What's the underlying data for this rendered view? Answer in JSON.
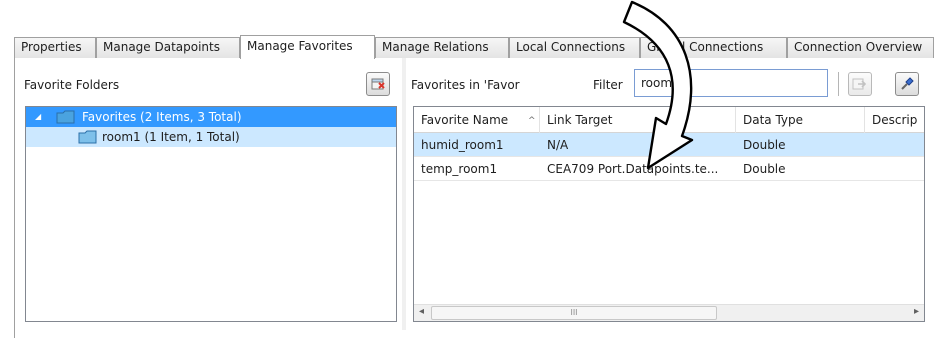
{
  "tabs": [
    {
      "label": "Properties"
    },
    {
      "label": "Manage Datapoints"
    },
    {
      "label": "Manage Favorites"
    },
    {
      "label": "Manage Relations"
    },
    {
      "label": "Local Connections"
    },
    {
      "label": "Global Connections"
    },
    {
      "label": "Connection Overview"
    }
  ],
  "active_tab": "Manage Favorites",
  "left": {
    "heading": "Favorite Folders",
    "add_button_icon": "add-folder-icon",
    "tree": [
      {
        "label": "Favorites (2 Items, 3 Total)",
        "selected": true,
        "expanded": true,
        "icon": "folder-icon"
      },
      {
        "label": "room1 (1 Item, 1 Total)",
        "selected": false,
        "icon": "folder-icon"
      }
    ]
  },
  "right": {
    "heading": "Favorites in 'Favor",
    "filter_label": "Filter",
    "filter_value": "room1",
    "export_button_icon": "export-icon",
    "pin_button_icon": "pin-icon",
    "columns": [
      "Favorite Name",
      "Link Target",
      "Data Type",
      "Descrip"
    ],
    "sort_indicator": "^",
    "rows": [
      {
        "name": "humid_room1",
        "target": "N/A",
        "type": "Double",
        "selected": true
      },
      {
        "name": "temp_room1",
        "target": "CEA709 Port.Datapoints.te...",
        "type": "Double",
        "selected": false
      }
    ],
    "scroll_left": "◂",
    "scroll_right": "▸",
    "scroll_grip": "III"
  },
  "annotation": {
    "icon": "curved-arrow-icon",
    "color": "#000000"
  },
  "colors": {
    "selection": "#3399ff",
    "selection_light": "#cce8ff",
    "folder": "#4aa3df"
  }
}
